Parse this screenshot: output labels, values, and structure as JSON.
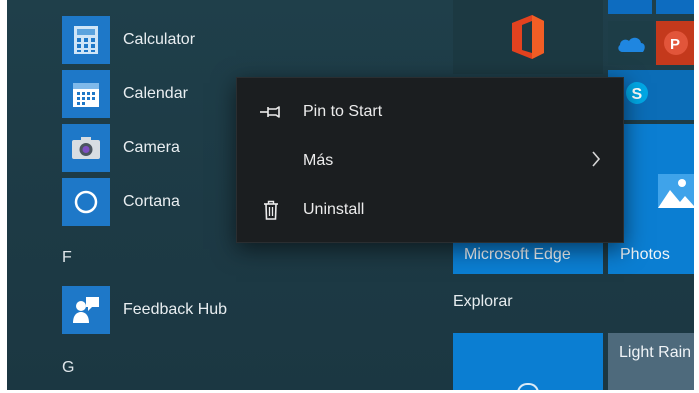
{
  "start_menu": {
    "app_list": [
      {
        "name": "Calculator",
        "icon": "calculator-icon"
      },
      {
        "name": "Calendar",
        "icon": "calendar-icon"
      },
      {
        "name": "Camera",
        "icon": "camera-icon"
      },
      {
        "name": "Cortana",
        "icon": "cortana-icon"
      }
    ],
    "section_f": {
      "letter": "F",
      "apps": [
        {
          "name": "Feedback Hub",
          "icon": "feedback-hub-icon"
        }
      ]
    },
    "section_g": {
      "letter": "G"
    }
  },
  "context_menu": {
    "items": [
      {
        "label": "Pin to Start",
        "icon": "pin-icon"
      },
      {
        "label": "Más",
        "icon": "chevron-right-icon"
      },
      {
        "label": "Uninstall",
        "icon": "trash-icon"
      }
    ]
  },
  "tiles": {
    "office": {
      "icon": "office-icon"
    },
    "onedrive": {
      "icon": "onedrive-icon"
    },
    "powerpoint": {
      "icon": "powerpoint-icon"
    },
    "skype": {
      "icon": "skype-icon"
    },
    "edge": {
      "label": "Microsoft Edge"
    },
    "photos": {
      "label": "Photos",
      "icon": "photos-icon"
    },
    "explore_group_title": "Explorar",
    "weather": {
      "label": "Light Rain"
    }
  },
  "colors": {
    "accent": "#1e78c8",
    "tile_blue": "#0b7ed2",
    "menu_bg": "#1b1e20",
    "office_orange": "#e3421f",
    "ppt_red": "#c4391c"
  }
}
